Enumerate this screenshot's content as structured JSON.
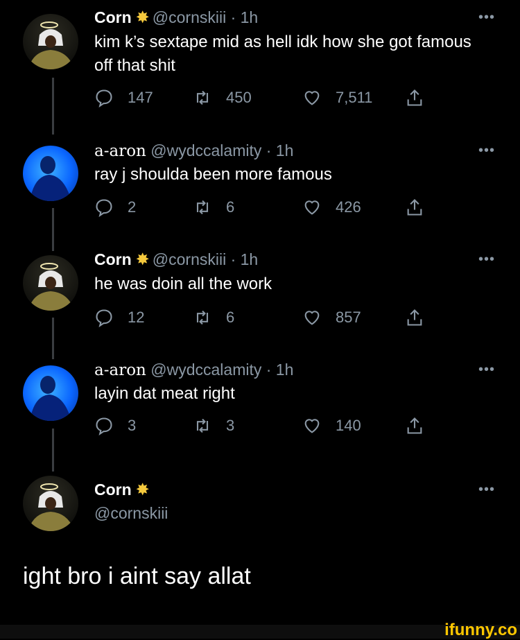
{
  "tweets": [
    {
      "name": "Corn",
      "has_star": true,
      "handle": "@cornskiii",
      "time": "· 1h",
      "text": "kim k’s sextape mid as hell idk how she got famous off that shit",
      "replies": "147",
      "retweets": "450",
      "likes": "7,511"
    },
    {
      "name": "a-aron",
      "has_star": false,
      "handle": "@wydccalamity",
      "time": "· 1h",
      "text": "ray j shoulda been more famous",
      "replies": "2",
      "retweets": "6",
      "likes": "426"
    },
    {
      "name": "Corn",
      "has_star": true,
      "handle": "@cornskiii",
      "time": "· 1h",
      "text": "he was doin all the work",
      "replies": "12",
      "retweets": "6",
      "likes": "857"
    },
    {
      "name": "a-aron",
      "has_star": false,
      "handle": "@wydccalamity",
      "time": "· 1h",
      "text": "layin dat meat right",
      "replies": "3",
      "retweets": "3",
      "likes": "140"
    }
  ],
  "final_tweet": {
    "name": "Corn",
    "handle": "@cornskiii",
    "text": "ight bro i aint say allat"
  },
  "more_label": "•••",
  "watermark": "ifunny.co",
  "colors": {
    "background": "#000000",
    "text": "#ffffff",
    "muted": "#8b98a5",
    "star": "#f5c93d",
    "watermark": "#ffc700"
  },
  "icons": [
    "reply-icon",
    "retweet-icon",
    "like-icon",
    "share-icon",
    "more-icon",
    "star-icon"
  ]
}
